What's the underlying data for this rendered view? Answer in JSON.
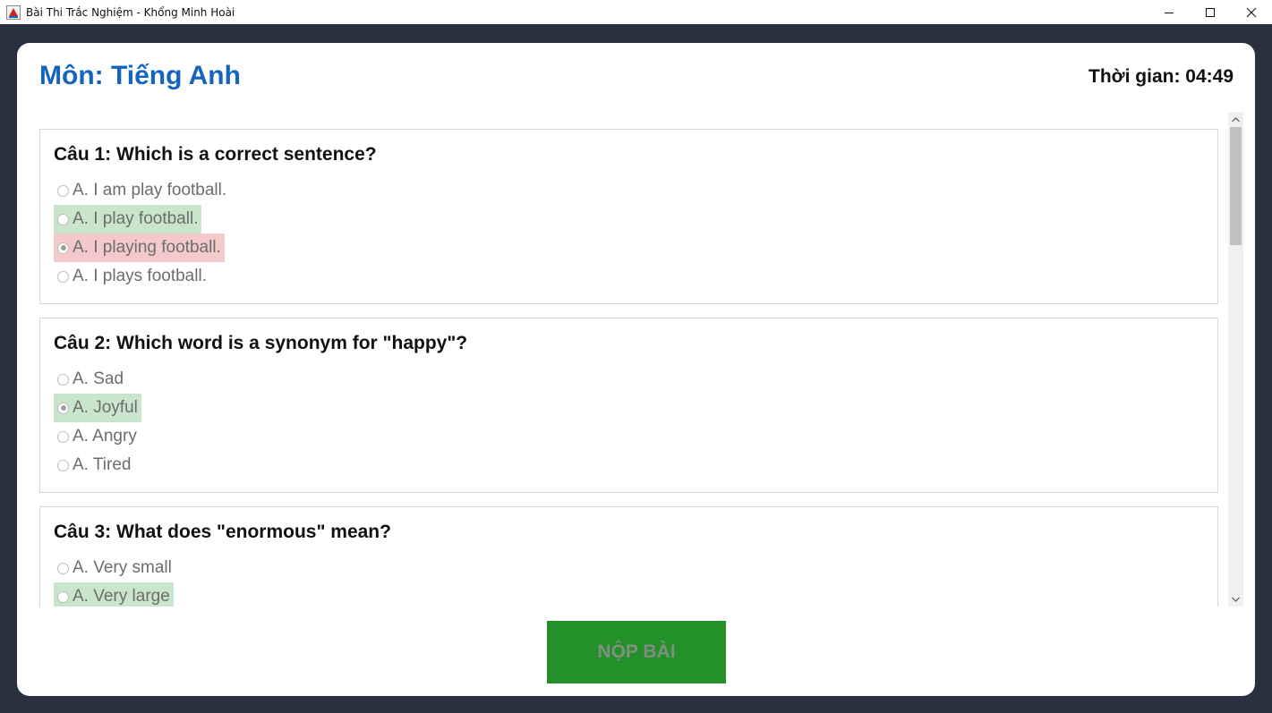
{
  "window": {
    "title": "Bài Thi Trắc Nghiệm - Khổng Minh Hoài"
  },
  "header": {
    "subject": "Môn: Tiếng Anh",
    "timer": "Thời gian: 04:49"
  },
  "questions": [
    {
      "title": "Câu 1: Which is a correct sentence?",
      "options": [
        {
          "label": "A. I am play football.",
          "state": "normal",
          "checked": false
        },
        {
          "label": "A. I play football.",
          "state": "correct",
          "checked": false
        },
        {
          "label": "A. I playing football.",
          "state": "wrong",
          "checked": true
        },
        {
          "label": "A. I plays football.",
          "state": "normal",
          "checked": false
        }
      ]
    },
    {
      "title": "Câu 2: Which word is a synonym for \"happy\"?",
      "options": [
        {
          "label": "A. Sad",
          "state": "normal",
          "checked": false
        },
        {
          "label": "A. Joyful",
          "state": "correct",
          "checked": true
        },
        {
          "label": "A. Angry",
          "state": "normal",
          "checked": false
        },
        {
          "label": "A. Tired",
          "state": "normal",
          "checked": false
        }
      ]
    },
    {
      "title": "Câu 3: What does \"enormous\" mean?",
      "options": [
        {
          "label": "A. Very small",
          "state": "normal",
          "checked": false
        },
        {
          "label": "A. Very large",
          "state": "correct",
          "checked": false
        }
      ]
    }
  ],
  "submit": {
    "label": "NỘP BÀI"
  },
  "colors": {
    "background": "#2b3040",
    "subject": "#1565c0",
    "correct_highlight": "#c9e6cc",
    "wrong_highlight": "#f3c9cb",
    "submit_bg": "#23902a"
  }
}
